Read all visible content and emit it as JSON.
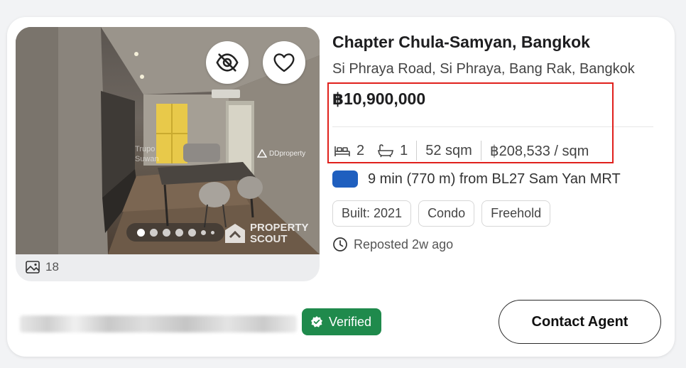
{
  "listing": {
    "title": "Chapter Chula-Samyan, Bangkok",
    "address": "Si Phraya Road, Si Phraya, Bang Rak, Bangkok",
    "price": "฿10,900,000",
    "bedrooms": "2",
    "bathrooms": "1",
    "area": "52 sqm",
    "price_per_sqm": "฿208,533 / sqm",
    "transit": "9 min (770 m) from BL27 Sam Yan MRT",
    "tags": [
      "Built: 2021",
      "Condo",
      "Freehold"
    ],
    "reposted": "Reposted 2w ago"
  },
  "photo": {
    "count": "18",
    "carousel_total_dots": 7,
    "carousel_active_index": 0,
    "watermark_brand_line1": "PROPERTY",
    "watermark_brand_line2": "SCOUT",
    "ddproperty_watermark": "DDproperty",
    "agent_watermark_line1": "Trupo",
    "agent_watermark_line2": "Suwan"
  },
  "footer": {
    "verified_label": "Verified",
    "contact_button": "Contact Agent"
  },
  "icons": {
    "hide": "eye-off-icon",
    "favorite": "heart-icon",
    "photos": "image-icon",
    "bed": "bed-icon",
    "bath": "bathtub-icon",
    "clock": "clock-icon",
    "verified": "badge-check-icon"
  },
  "colors": {
    "highlight_border": "#e0201c",
    "transit_badge": "#1f5fbf",
    "verified_bg": "#1f8a4c"
  }
}
